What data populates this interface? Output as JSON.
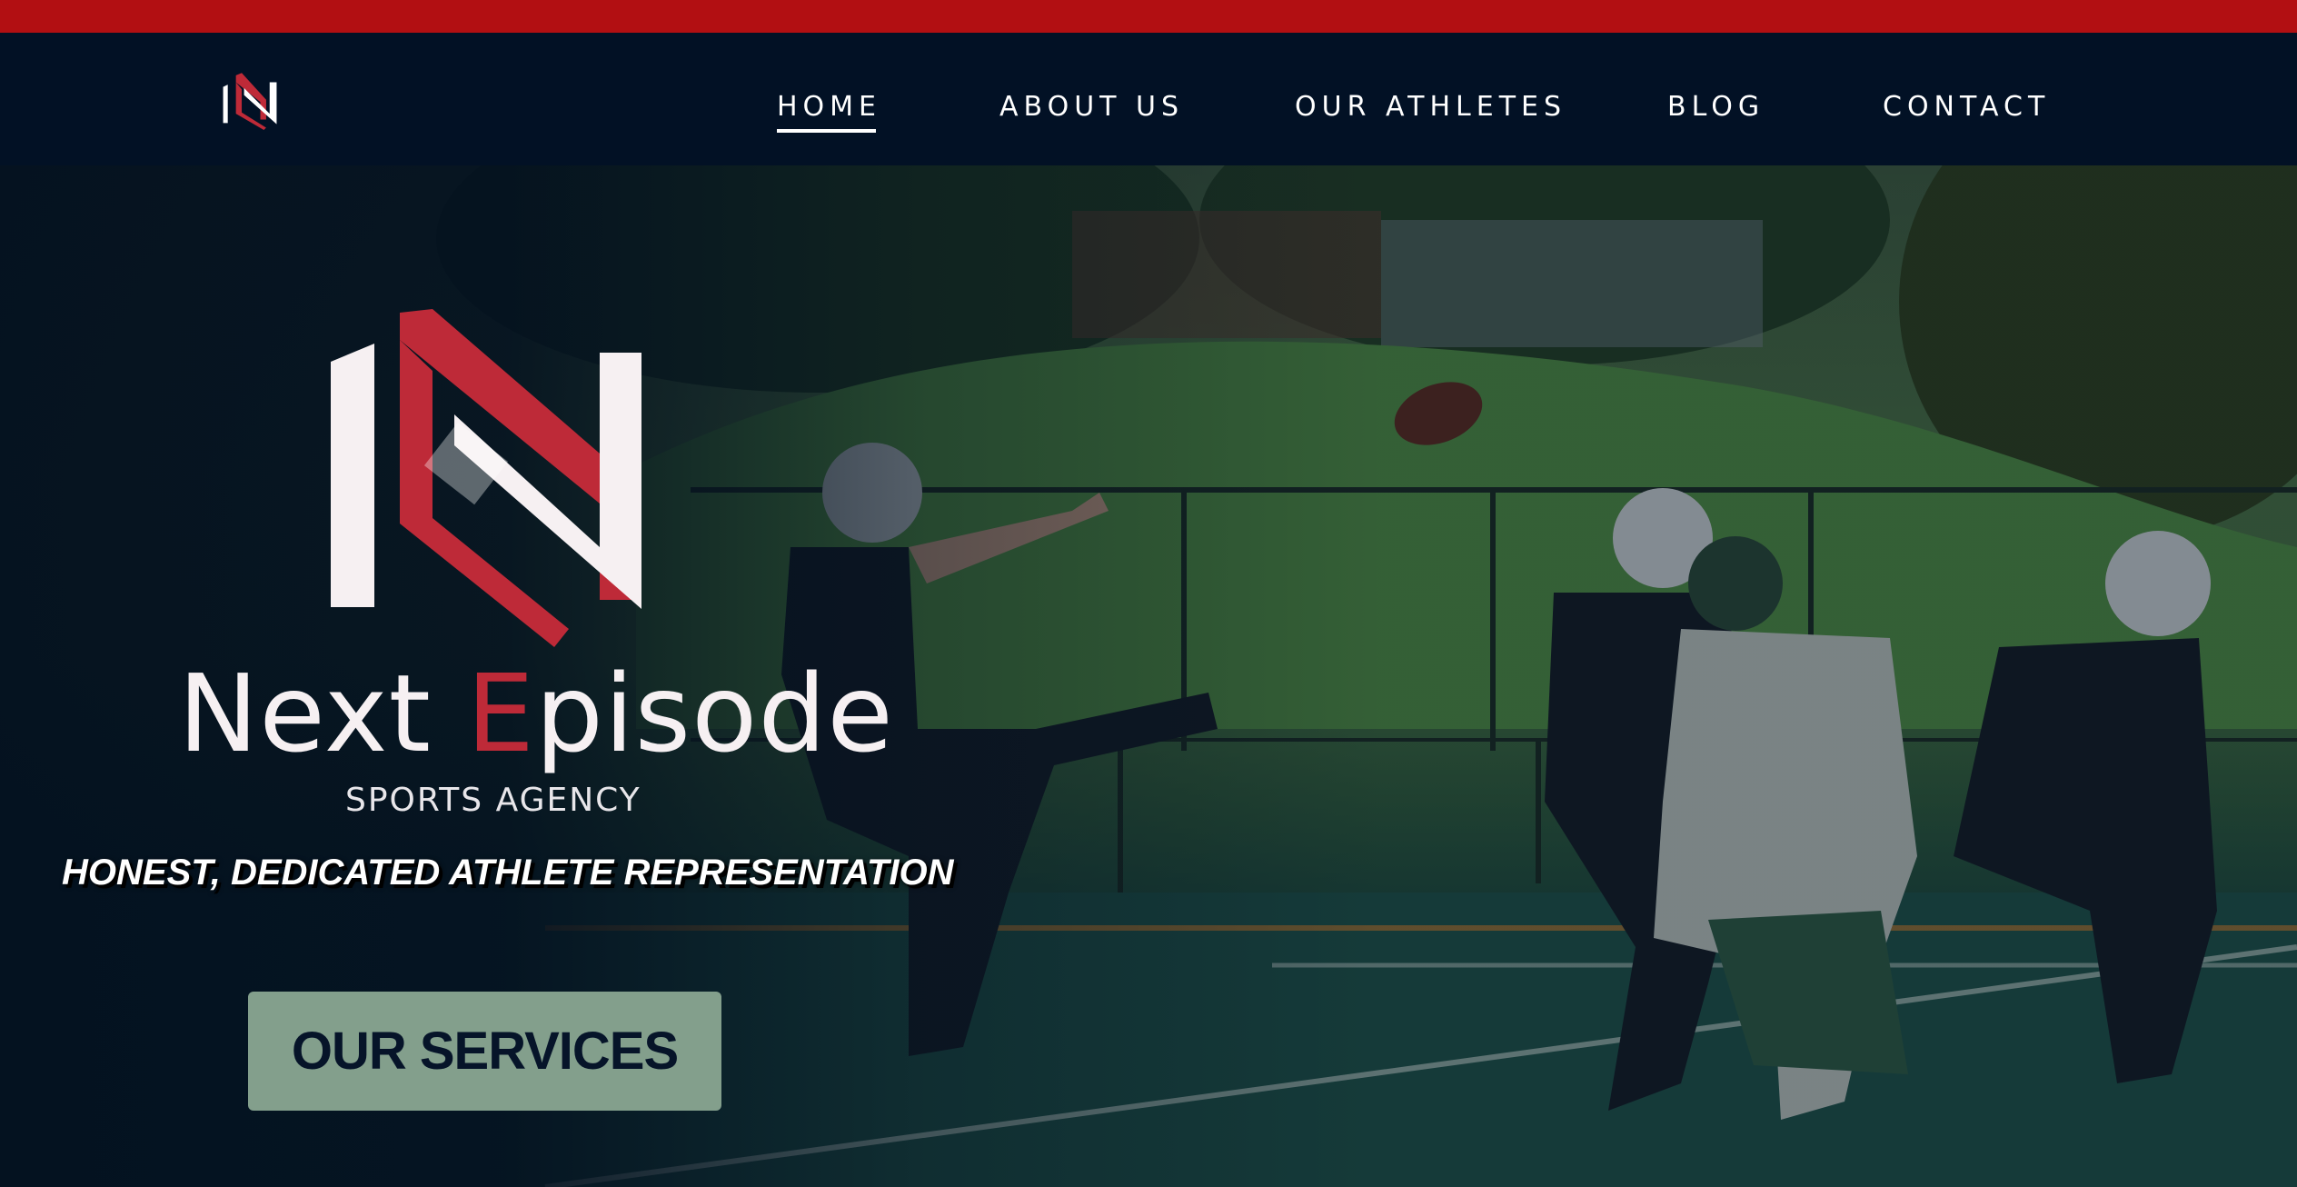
{
  "colors": {
    "top_stripe": "#b20f12",
    "header_bg": "#021125",
    "accent_red": "#be2a38",
    "cta_bg": "#839f8c",
    "cta_text": "#061429"
  },
  "header": {
    "logo_icon": "ne-monogram-icon",
    "nav": [
      {
        "label": "HOME",
        "active": true
      },
      {
        "label": "ABOUT US",
        "active": false
      },
      {
        "label": "OUR ATHLETES",
        "active": false
      },
      {
        "label": "BLOG",
        "active": false
      },
      {
        "label": "CONTACT",
        "active": false
      }
    ]
  },
  "hero": {
    "background_image": "football-players-field-photo",
    "brand": {
      "name_first": "Next ",
      "name_accent": "E",
      "name_rest": "pisode",
      "subtitle": "SPORTS AGENCY"
    },
    "tagline": "HONEST, DEDICATED ATHLETE REPRESENTATION",
    "cta_label": "OUR SERVICES"
  }
}
